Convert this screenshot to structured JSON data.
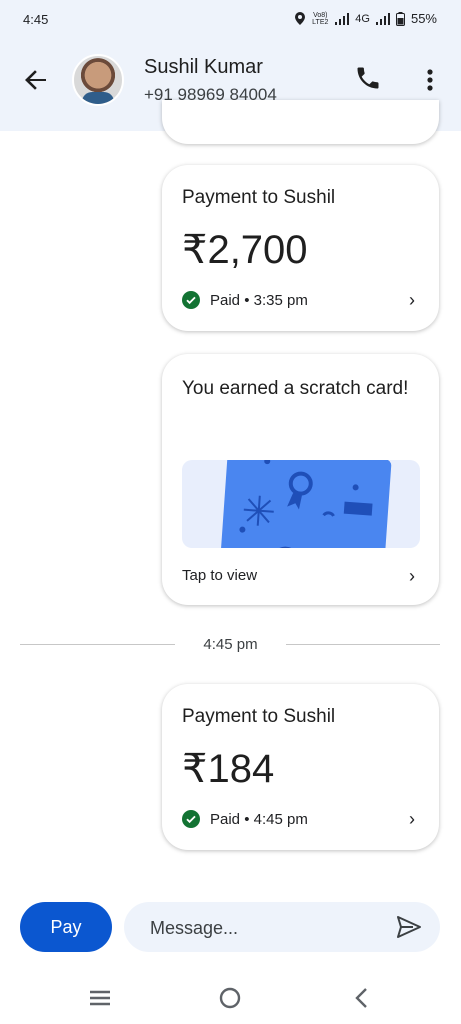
{
  "status_bar": {
    "time": "4:45",
    "net_top": "Vo8) LTE2",
    "net_4g": "4G",
    "battery": "55%"
  },
  "header": {
    "contact_name": "Sushil Kumar",
    "phone": "+91 98969 84004"
  },
  "messages": [
    {
      "title": "Payment to Sushil",
      "amount": "₹2,700",
      "status": "Paid • 3:35 pm"
    },
    {
      "scratch_title": "You earned a scratch card!",
      "action": "Tap to view"
    },
    {
      "divider_time": "4:45 pm"
    },
    {
      "title": "Payment to Sushil",
      "amount": "₹184",
      "status": "Paid • 4:45 pm"
    }
  ],
  "composer": {
    "pay_label": "Pay",
    "placeholder": "Message..."
  },
  "colors": {
    "accent": "#0b57d0",
    "header_bg": "#eef3fb",
    "paid_green": "#137333",
    "scratch_blue": "#4a86f0"
  },
  "icons": [
    "back-arrow-icon",
    "phone-icon",
    "more-vert-icon",
    "check-icon",
    "chevron-right-icon",
    "send-icon",
    "recents-icon",
    "home-icon",
    "nav-back-icon"
  ]
}
